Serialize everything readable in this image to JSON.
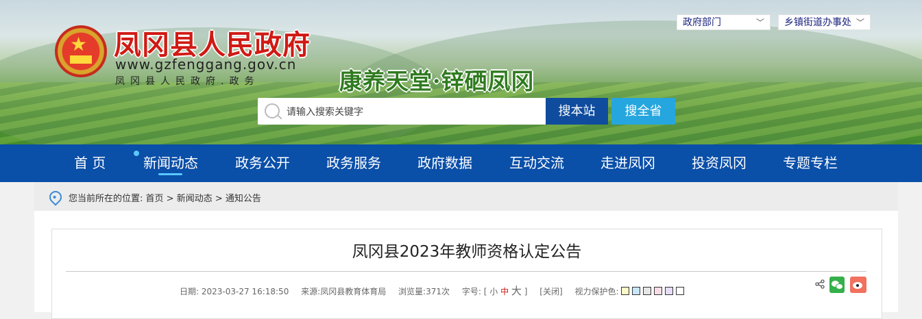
{
  "header": {
    "title": "凤冈县人民政府",
    "url": "www.gzfenggang.gov.cn",
    "subtitle": "凤冈县人民政府.政务",
    "slogan": "康养天堂·锌硒凤冈",
    "dept_select": "政府部门",
    "town_select": "乡镇街道办事处",
    "search_placeholder": "请输入搜索关键字",
    "search_site_label": "搜本站",
    "search_province_label": "搜全省"
  },
  "nav": {
    "items": [
      "首 页",
      "新闻动态",
      "政务公开",
      "政务服务",
      "政府数据",
      "互动交流",
      "走进凤冈",
      "投资凤冈",
      "专题专栏"
    ],
    "active_index": 1
  },
  "breadcrumb": {
    "prefix": "您当前所在的位置: ",
    "items": [
      "首页",
      "新闻动态",
      "通知公告"
    ],
    "separator": " > "
  },
  "article": {
    "title": "凤冈县2023年教师资格认定公告",
    "date_label": "日期:",
    "date": "2023-03-27 16:18:50",
    "source_label": "来源:",
    "source": "凤冈县教育体育局",
    "views_label": "浏览量:",
    "views": "371次",
    "font_label": "字号:",
    "font_open": "[",
    "font_small": "小",
    "font_medium": "中",
    "font_large": "大",
    "font_close": "]",
    "close_label": "[关闭]",
    "eye_label": "视力保护色:",
    "eye_colors": [
      "#fafac8",
      "#c8e6fa",
      "#e6e6e6",
      "#fadce6",
      "#e6dcfa",
      "#ffffff"
    ]
  },
  "colors": {
    "nav_bg": "#0a4fa8",
    "title_red": "#d01a14",
    "search_site_btn": "#0f4c9e",
    "search_province_btn": "#26a6de"
  }
}
